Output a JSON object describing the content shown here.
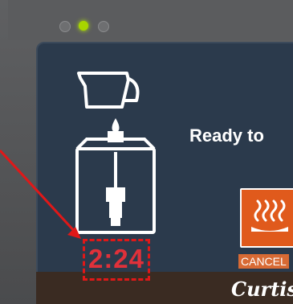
{
  "status": {
    "text": "Ready to"
  },
  "timer": {
    "value": "2:24"
  },
  "controls": {
    "cancel_label": "CANCEL"
  },
  "brand": {
    "name": "Curtis"
  },
  "colors": {
    "screen_background": "#2b3a4c",
    "timer_red": "#e0313a",
    "annotation_red": "#e01818",
    "hold_button_orange": "#e05a1c",
    "led_green": "#a8d600"
  },
  "icons": {
    "pour_icon": "pitcher-icon",
    "drop_icon": "drop-icon",
    "dispenser_icon": "satellite-server-icon",
    "hold_icon": "heat-waves-icon",
    "arrow": "annotation-arrow"
  },
  "indicators": [
    {
      "name": "led-left",
      "state": "off"
    },
    {
      "name": "led-center",
      "state": "on"
    },
    {
      "name": "led-right",
      "state": "off"
    }
  ]
}
